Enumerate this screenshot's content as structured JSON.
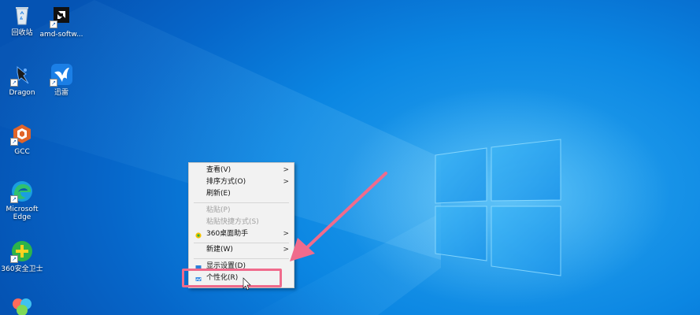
{
  "desktop_icons": [
    {
      "label": "回收站",
      "icon": "recycle-bin-icon"
    },
    {
      "label": "amd-softw...",
      "icon": "amd-software-icon"
    },
    {
      "label": "Dragon",
      "icon": "dragon-app-icon"
    },
    {
      "label": "迅雷",
      "icon": "xunlei-bird-icon"
    },
    {
      "label": "GCC",
      "icon": "gcc-icon"
    },
    {
      "label_line1": "Microsoft",
      "label_line2": "Edge",
      "icon": "edge-icon"
    },
    {
      "label": "360安全卫士",
      "icon": "360-safe-icon"
    },
    {
      "label": "",
      "icon": "app-icon-partial"
    }
  ],
  "context_menu": {
    "items": [
      {
        "label": "查看(V)",
        "has_submenu": true,
        "enabled": true
      },
      {
        "label": "排序方式(O)",
        "has_submenu": true,
        "enabled": true
      },
      {
        "label": "刷新(E)",
        "has_submenu": false,
        "enabled": true
      },
      {
        "label": "粘贴(P)",
        "has_submenu": false,
        "enabled": false
      },
      {
        "label": "粘贴快捷方式(S)",
        "has_submenu": false,
        "enabled": false
      },
      {
        "label": "360桌面助手",
        "has_submenu": true,
        "enabled": true,
        "icon": "360-desktop-icon"
      },
      {
        "label": "新建(W)",
        "has_submenu": true,
        "enabled": true
      },
      {
        "label": "显示设置(D)",
        "has_submenu": false,
        "enabled": true,
        "icon": "display-settings-icon"
      },
      {
        "label": "个性化(R)",
        "has_submenu": false,
        "enabled": true,
        "icon": "personalize-icon"
      }
    ],
    "submenu_arrow": ">"
  },
  "annotation": {
    "highlight_color": "#f06b8c",
    "highlighted_item": "个性化(R)"
  },
  "colors": {
    "desktop_blue": "#0b86e2",
    "menu_bg": "#f2f2f2"
  }
}
